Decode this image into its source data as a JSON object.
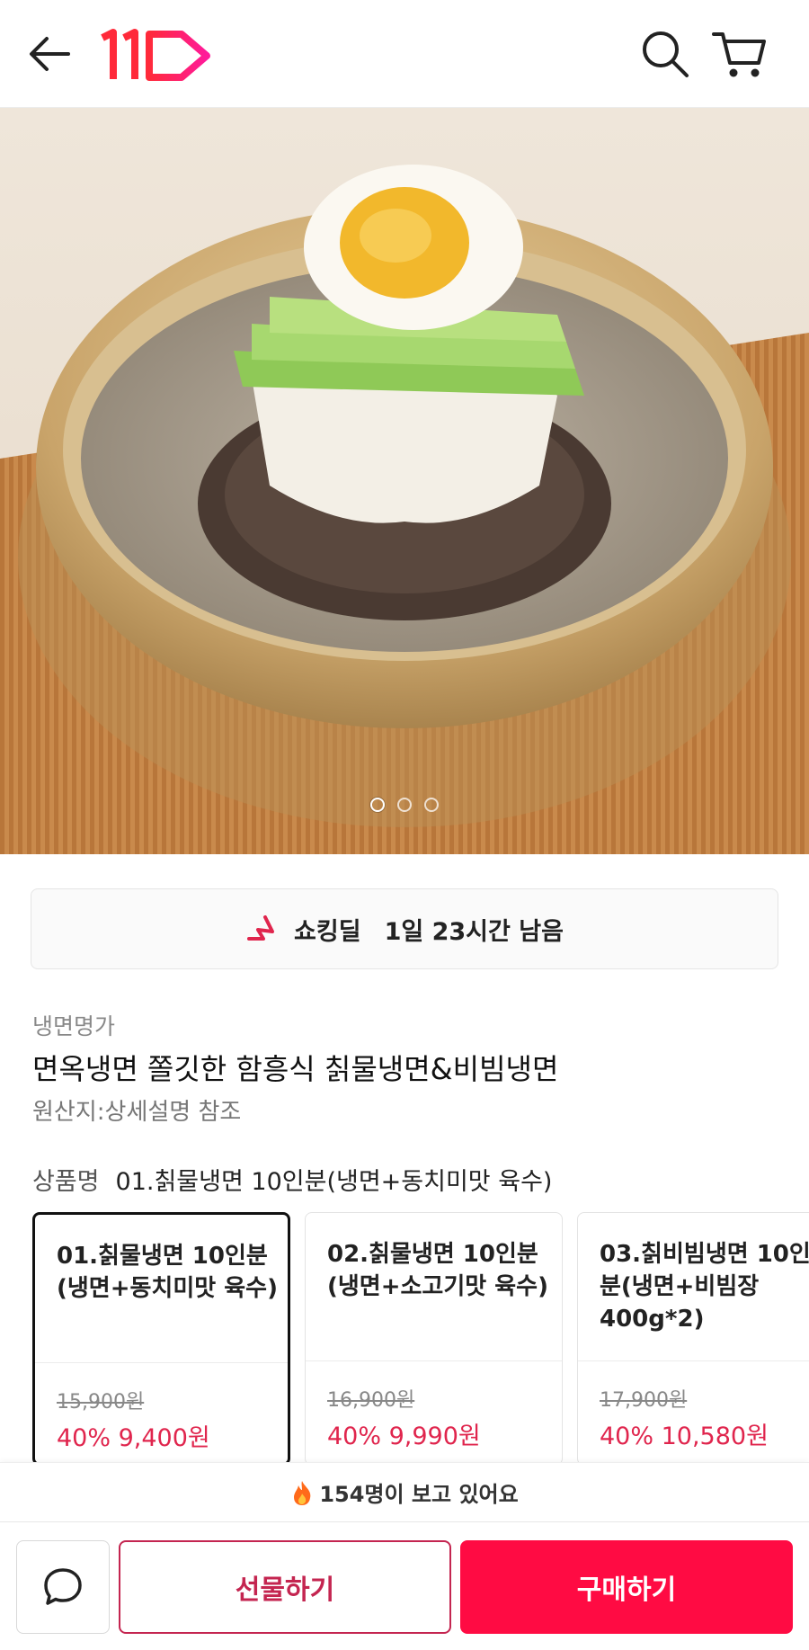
{
  "header": {
    "back_icon": "arrow-left-icon",
    "logo_text": "11",
    "search_icon": "search-icon",
    "cart_icon": "cart-icon"
  },
  "hero": {
    "image_description_icon": "product-photo",
    "carousel": {
      "total": 3,
      "active_index": 0
    }
  },
  "deal": {
    "icon": "shocking-deal-icon",
    "label": "쇼킹딜",
    "time_left": "1일 23시간 남음",
    "accent": "#e0254d"
  },
  "product": {
    "seller": "냉면명가",
    "title": "면옥냉면 쫄깃한 함흥식 칡물냉면&비빔냉면",
    "origin": "원산지:상세설명 참조",
    "option_key": "상품명",
    "option_selected": "01.칡물냉면 10인분(냉면+동치미맛 육수)"
  },
  "options": [
    {
      "name": "01.칡물냉면 10인분(냉면+동치미맛 육수)",
      "original_price": "15,900원",
      "discount": "40%",
      "sale_price": "9,400원",
      "selected": true
    },
    {
      "name": "02.칡물냉면 10인분(냉면+소고기맛 육수)",
      "original_price": "16,900원",
      "discount": "40%",
      "sale_price": "9,990원",
      "selected": false
    },
    {
      "name": "03.칡비빔냉면 10인분(냉면+비빔장 400g*2)",
      "original_price": "17,900원",
      "discount": "40%",
      "sale_price": "10,580원",
      "selected": false
    }
  ],
  "viewing": {
    "icon": "fire-icon",
    "text": "154명이 보고 있어요"
  },
  "actions": {
    "chat_icon": "chat-bubble-icon",
    "gift_label": "선물하기",
    "buy_label": "구매하기",
    "brand_color": "#ff0b43",
    "gift_color": "#c42550"
  }
}
